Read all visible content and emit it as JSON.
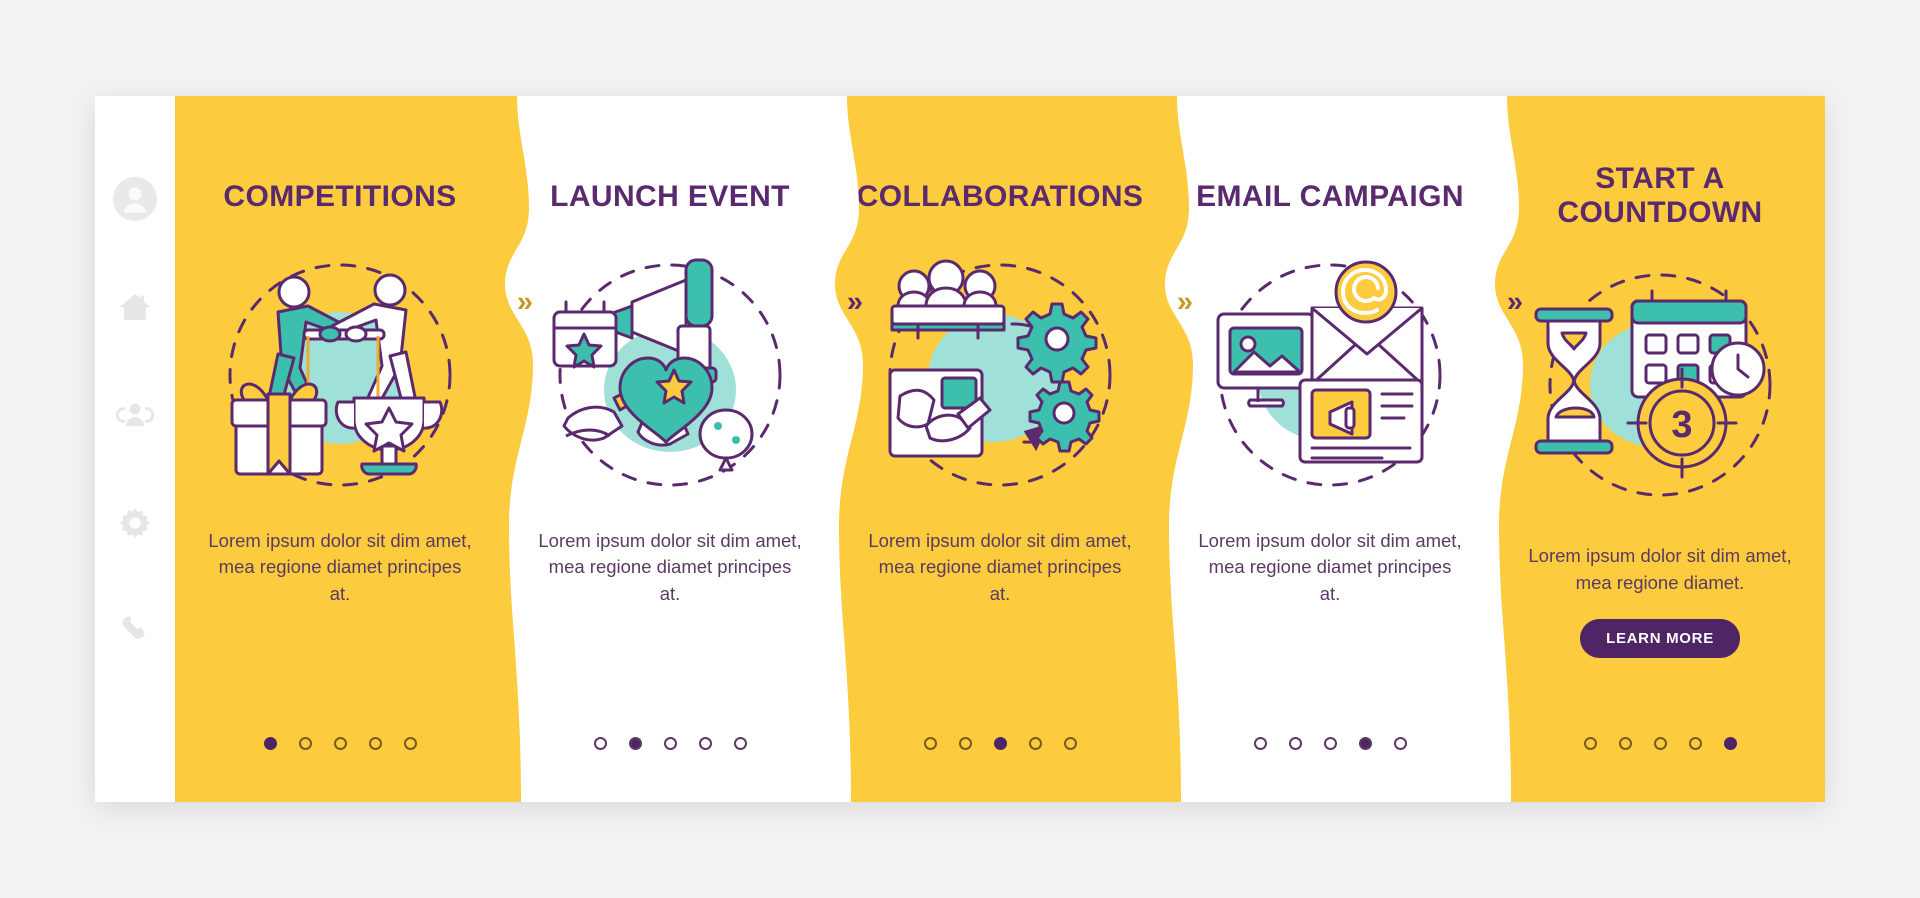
{
  "theme": {
    "yellow": "#fdcb3e",
    "white": "#ffffff",
    "purple": "#5b2a6e",
    "deep_purple": "#4f2566",
    "teal": "#3dbfae",
    "page_bg": "#f2f2f2"
  },
  "sidebar": {
    "items": [
      {
        "icon": "avatar-icon",
        "name": "profile"
      },
      {
        "icon": "home-icon",
        "name": "home"
      },
      {
        "icon": "users-icon",
        "name": "users"
      },
      {
        "icon": "gear-icon",
        "name": "settings"
      },
      {
        "icon": "phone-icon",
        "name": "contact"
      }
    ]
  },
  "separator": {
    "glyph": "»"
  },
  "cards": [
    {
      "title": "COMPETITIONS",
      "bg": "yellow",
      "illustration": "competition-illustration",
      "body": "Lorem ipsum dolor sit dim amet, mea regione diamet principes at.",
      "dots": {
        "count": 5,
        "active": 0
      },
      "cta": null
    },
    {
      "title": "LAUNCH EVENT",
      "bg": "white",
      "illustration": "launch-event-illustration",
      "body": "Lorem ipsum dolor sit dim amet, mea regione diamet principes at.",
      "dots": {
        "count": 5,
        "active": 1
      },
      "cta": null
    },
    {
      "title": "COLLABORATIONS",
      "bg": "yellow",
      "illustration": "collaborations-illustration",
      "body": "Lorem ipsum dolor sit dim amet, mea regione diamet principes at.",
      "dots": {
        "count": 5,
        "active": 2
      },
      "cta": null
    },
    {
      "title": "EMAIL CAMPAIGN",
      "bg": "white",
      "illustration": "email-campaign-illustration",
      "body": "Lorem ipsum dolor sit dim amet, mea regione diamet principes at.",
      "dots": {
        "count": 5,
        "active": 3
      },
      "cta": null
    },
    {
      "title": "START A COUNTDOWN",
      "bg": "yellow",
      "illustration": "countdown-illustration",
      "body": "Lorem ipsum dolor sit dim amet, mea regione diamet.",
      "dots": {
        "count": 5,
        "active": 4
      },
      "cta": "LEARN MORE"
    }
  ]
}
